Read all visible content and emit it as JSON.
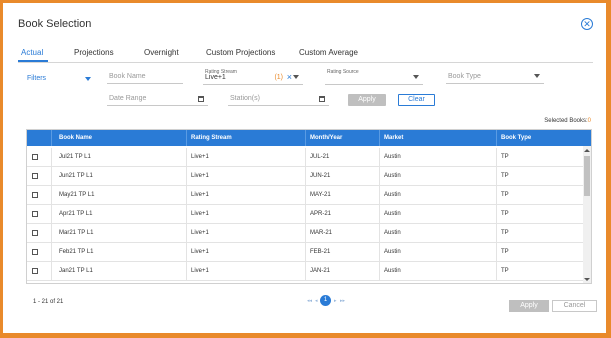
{
  "dialog": {
    "title": "Book Selection"
  },
  "tabs": [
    {
      "label": "Actual",
      "active": true
    },
    {
      "label": "Projections",
      "active": false
    },
    {
      "label": "Overnight",
      "active": false
    },
    {
      "label": "Custom Projections",
      "active": false
    },
    {
      "label": "Custom Average",
      "active": false
    }
  ],
  "filters": {
    "label": "Filters",
    "book_name_placeholder": "Book Name",
    "rating_stream_label": "Rating Stream",
    "rating_stream_value": "Live+1",
    "rating_stream_count": "(1)",
    "rating_source_label": "Rating Source",
    "book_type_placeholder": "Book Type",
    "date_range_placeholder": "Date Range",
    "stations_placeholder": "Station(s)",
    "apply_label": "Apply",
    "clear_label": "Clear"
  },
  "selected_books": {
    "label": "Selected Books:",
    "count": "0"
  },
  "table": {
    "headers": [
      "Book Name",
      "Rating Stream",
      "Month/Year",
      "Market",
      "Book Type"
    ],
    "rows": [
      [
        "Jul21 TP L1",
        "Live+1",
        "JUL-21",
        "Austin",
        "TP"
      ],
      [
        "Jun21 TP L1",
        "Live+1",
        "JUN-21",
        "Austin",
        "TP"
      ],
      [
        "May21 TP L1",
        "Live+1",
        "MAY-21",
        "Austin",
        "TP"
      ],
      [
        "Apr21 TP L1",
        "Live+1",
        "APR-21",
        "Austin",
        "TP"
      ],
      [
        "Mar21 TP L1",
        "Live+1",
        "MAR-21",
        "Austin",
        "TP"
      ],
      [
        "Feb21 TP L1",
        "Live+1",
        "FEB-21",
        "Austin",
        "TP"
      ],
      [
        "Jan21 TP L1",
        "Live+1",
        "JAN-21",
        "Austin",
        "TP"
      ]
    ]
  },
  "footer": {
    "range_text": "1 - 21 of 21",
    "current_page": "1",
    "apply_label": "Apply",
    "cancel_label": "Cancel"
  },
  "colors": {
    "accent": "#2a7bd6",
    "frame": "#e98a2b",
    "disabled": "#bfbfbf"
  }
}
